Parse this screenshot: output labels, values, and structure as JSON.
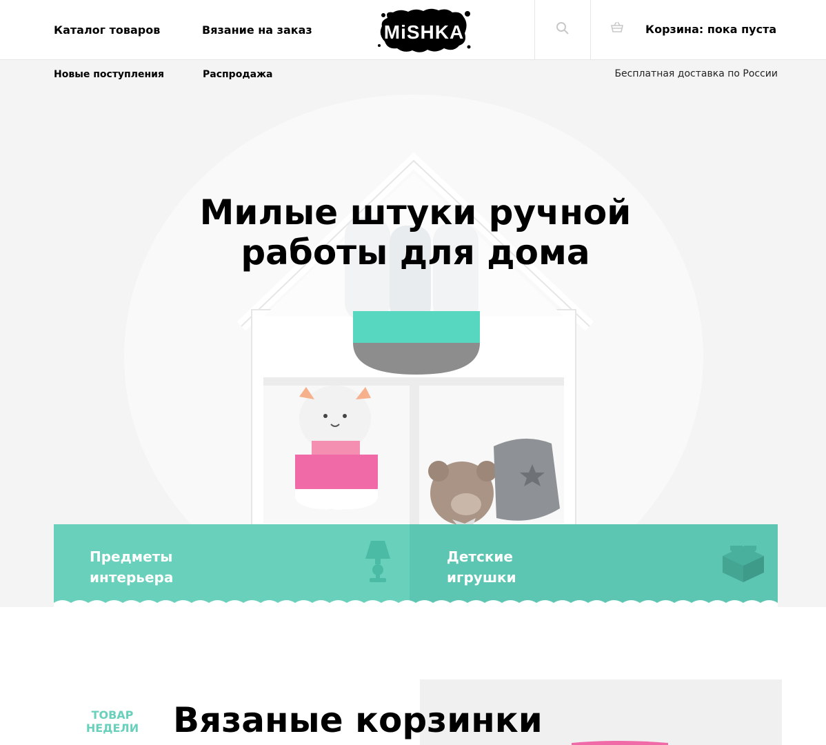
{
  "header": {
    "nav": [
      {
        "label": "Каталог товаров"
      },
      {
        "label": "Вязание на заказ"
      }
    ],
    "logo_text": "MiSHKA",
    "cart_label": "Корзина: пока пуста"
  },
  "subnav": {
    "items": [
      {
        "label": "Новые поступления"
      },
      {
        "label": "Распродажа"
      }
    ],
    "delivery_note": "Бесплатная доставка по России"
  },
  "hero": {
    "title": "Милые штуки ручной работы для дома"
  },
  "categories": [
    {
      "label": "Предметы интерьера",
      "icon": "lamp-icon"
    },
    {
      "label": "Детские игрушки",
      "icon": "lego-brick-icon"
    }
  ],
  "product_of_week": {
    "badge": "Товар недели",
    "title": "Вязаные корзинки"
  },
  "colors": {
    "accent": "#68d0bb",
    "accent_dark": "#5cc6b2",
    "text": "#000000",
    "hero_bg": "#f4f4f4"
  }
}
